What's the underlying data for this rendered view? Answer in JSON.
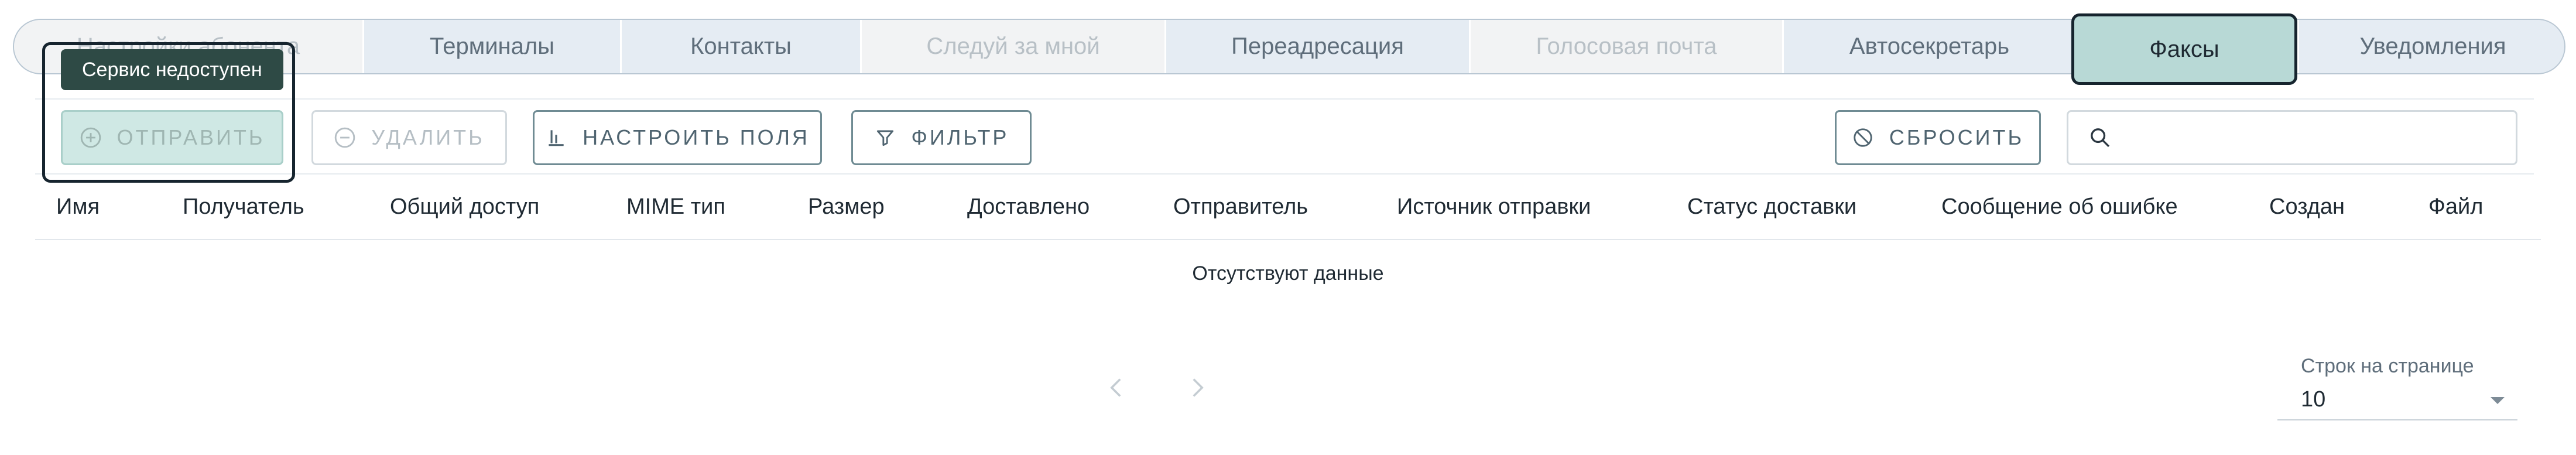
{
  "tabs": [
    {
      "label": "Настройки абонента",
      "state": "disabled"
    },
    {
      "label": "Терминалы",
      "state": "normal"
    },
    {
      "label": "Контакты",
      "state": "normal"
    },
    {
      "label": "Следуй за мной",
      "state": "disabled"
    },
    {
      "label": "Переадресация",
      "state": "normal"
    },
    {
      "label": "Голосовая почта",
      "state": "disabled"
    },
    {
      "label": "Автосекретарь",
      "state": "normal"
    },
    {
      "label": "Факсы",
      "state": "active"
    },
    {
      "label": "Уведомления",
      "state": "normal"
    }
  ],
  "tooltip": "Сервис недоступен",
  "toolbar": {
    "send": {
      "label": "ОТПРАВИТЬ",
      "icon": "plus-circle-icon",
      "disabled": true
    },
    "delete": {
      "label": "УДАЛИТЬ",
      "icon": "minus-circle-icon",
      "disabled": true
    },
    "columns": {
      "label": "НАСТРОИТЬ ПОЛЯ",
      "icon": "columns-icon"
    },
    "filter": {
      "label": "ФИЛЬТР",
      "icon": "filter-icon"
    },
    "reset": {
      "label": "СБРОСИТЬ",
      "icon": "reset-icon"
    },
    "search": {
      "icon": "search-icon",
      "placeholder": ""
    }
  },
  "table": {
    "columns": [
      "Имя",
      "Получатель",
      "Общий доступ",
      "MIME тип",
      "Размер",
      "Доставлено",
      "Отправитель",
      "Источник отправки",
      "Статус доставки",
      "Сообщение об ошибке",
      "Создан",
      "Файл"
    ],
    "rows": [],
    "empty_text": "Отсутствуют данные"
  },
  "pagination": {
    "rows_per_page_label": "Строк на странице",
    "rows_per_page": "10"
  },
  "colors": {
    "accent": "#b8d9d6",
    "tab_bg": "#e5ecf3",
    "tooltip_bg": "#2e4a45",
    "button_border": "#6f8b93"
  }
}
